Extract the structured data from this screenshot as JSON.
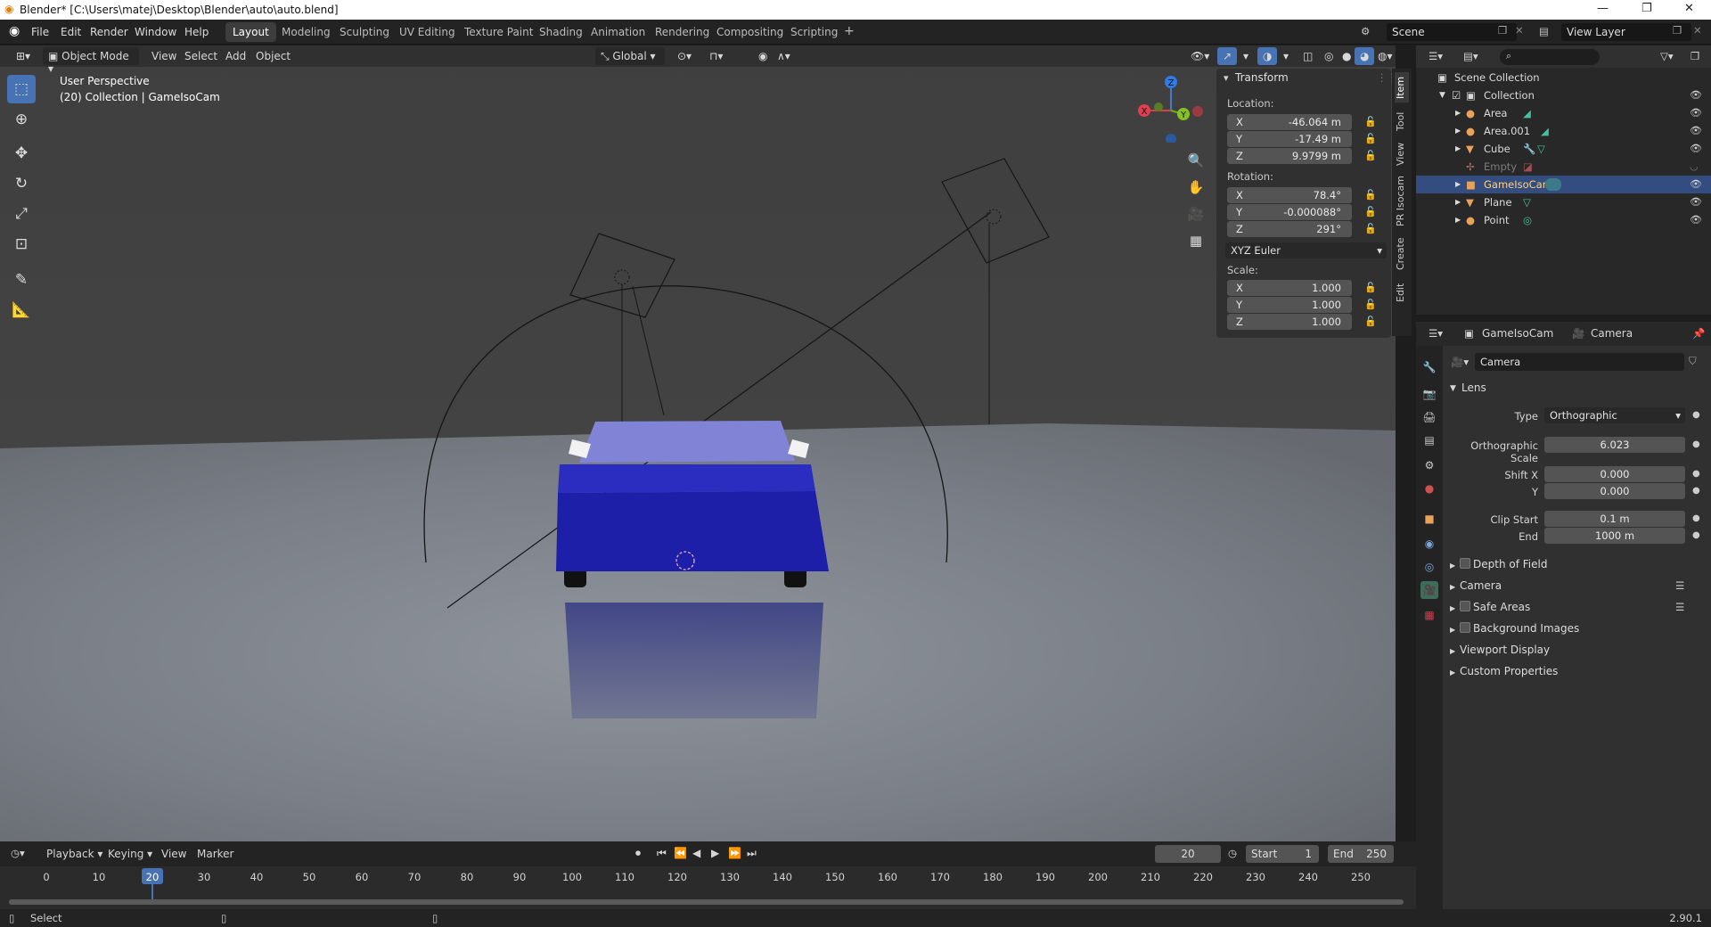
{
  "window": {
    "title": "Blender* [C:\\Users\\matej\\Desktop\\Blender\\auto\\auto.blend]"
  },
  "menu": [
    "File",
    "Edit",
    "Render",
    "Window",
    "Help"
  ],
  "workspaces": [
    "Layout",
    "Modeling",
    "Sculpting",
    "UV Editing",
    "Texture Paint",
    "Shading",
    "Animation",
    "Rendering",
    "Compositing",
    "Scripting"
  ],
  "active_workspace": "Layout",
  "scene": {
    "name": "Scene",
    "view_layer": "View Layer"
  },
  "viewport_header": {
    "mode": "Object Mode",
    "menus": [
      "View",
      "Select",
      "Add",
      "Object"
    ],
    "orientation": "Global"
  },
  "viewport": {
    "perspective": "User Perspective",
    "collection_info": "(20) Collection | GameIsoCam"
  },
  "gizmo": {
    "x": "X",
    "y": "Y",
    "z": "Z"
  },
  "npanel": {
    "header": "Transform",
    "location_label": "Location:",
    "location": [
      {
        "axis": "X",
        "value": "-46.064 m"
      },
      {
        "axis": "Y",
        "value": "-17.49 m"
      },
      {
        "axis": "Z",
        "value": "9.9799 m"
      }
    ],
    "rotation_label": "Rotation:",
    "rotation": [
      {
        "axis": "X",
        "value": "78.4°"
      },
      {
        "axis": "Y",
        "value": "-0.000088°"
      },
      {
        "axis": "Z",
        "value": "291°"
      }
    ],
    "rotation_mode": "XYZ Euler",
    "scale_label": "Scale:",
    "scale": [
      {
        "axis": "X",
        "value": "1.000"
      },
      {
        "axis": "Y",
        "value": "1.000"
      },
      {
        "axis": "Z",
        "value": "1.000"
      }
    ],
    "tabs": [
      "Item",
      "Tool",
      "View",
      "PR Isocam",
      "Create",
      "Edit"
    ]
  },
  "outliner": {
    "root": "Scene Collection",
    "collection": "Collection",
    "items": [
      {
        "name": "Area",
        "selected": false,
        "dim": false
      },
      {
        "name": "Area.001",
        "selected": false,
        "dim": false
      },
      {
        "name": "Cube",
        "selected": false,
        "dim": false
      },
      {
        "name": "Empty",
        "selected": false,
        "dim": true
      },
      {
        "name": "GameIsoCam",
        "selected": true,
        "dim": false
      },
      {
        "name": "Plane",
        "selected": false,
        "dim": false
      },
      {
        "name": "Point",
        "selected": false,
        "dim": false
      }
    ]
  },
  "properties": {
    "object_name": "GameIsoCam",
    "data_name": "Camera",
    "datablock": "Camera",
    "lens_section": "Lens",
    "type_label": "Type",
    "type_value": "Orthographic",
    "ortho_scale_label": "Orthographic Scale",
    "ortho_scale_value": "6.023",
    "shift_x_label": "Shift X",
    "shift_x_value": "0.000",
    "shift_y_label": "Y",
    "shift_y_value": "0.000",
    "clip_start_label": "Clip Start",
    "clip_start_value": "0.1 m",
    "clip_end_label": "End",
    "clip_end_value": "1000 m",
    "sections": [
      "Depth of Field",
      "Camera",
      "Safe Areas",
      "Background Images",
      "Viewport Display",
      "Custom Properties"
    ]
  },
  "timeline": {
    "menus": [
      "Playback",
      "Keying",
      "View",
      "Marker"
    ],
    "current_frame": "20",
    "start_label": "Start",
    "start": "1",
    "end_label": "End",
    "end": "250",
    "ticks": [
      "0",
      "10",
      "20",
      "30",
      "40",
      "50",
      "60",
      "70",
      "80",
      "90",
      "100",
      "110",
      "120",
      "130",
      "140",
      "150",
      "160",
      "170",
      "180",
      "190",
      "200",
      "210",
      "220",
      "230",
      "240",
      "250"
    ]
  },
  "status": {
    "left": "Select",
    "version": "2.90.1"
  }
}
